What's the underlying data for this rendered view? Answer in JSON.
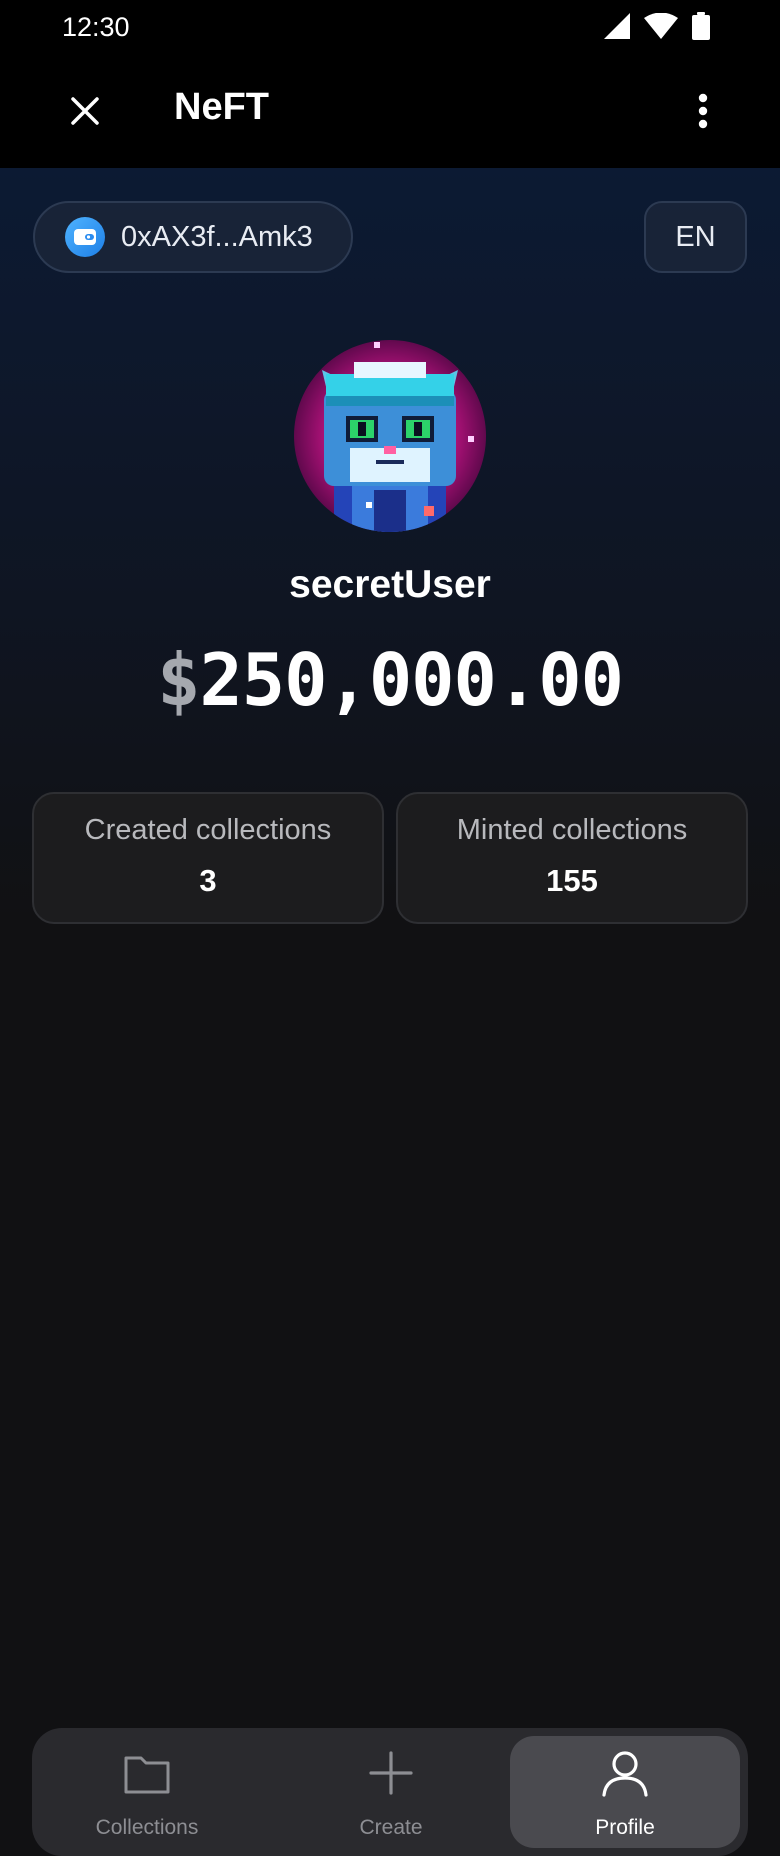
{
  "status_bar": {
    "time": "12:30",
    "icons": [
      "signal-icon",
      "wifi-icon",
      "battery-icon"
    ]
  },
  "app_bar": {
    "title": "NeFT",
    "close_icon": "close-icon",
    "menu_icon": "more-vert-icon"
  },
  "wallet": {
    "address": "0xAX3f...Amk3",
    "icon": "wallet-icon"
  },
  "language": {
    "label": "EN"
  },
  "profile": {
    "username": "secretUser",
    "balance_currency": "$",
    "balance_amount": "250,000.00"
  },
  "stats": [
    {
      "label": "Created collections",
      "value": "3"
    },
    {
      "label": "Minted collections",
      "value": "155"
    }
  ],
  "bottom_nav": {
    "items": [
      {
        "label": "Collections",
        "icon": "folder-icon",
        "active": false
      },
      {
        "label": "Create",
        "icon": "plus-icon",
        "active": false
      },
      {
        "label": "Profile",
        "icon": "person-icon",
        "active": true
      }
    ]
  },
  "colors": {
    "background": "#111113",
    "header_gradient_top": "#0c1a33",
    "card_background": "#1c1c1e",
    "nav_background": "#2a2a2e",
    "nav_active": "#4a4a4f",
    "wallet_icon": "#2a8cf0",
    "avatar_glow": "#e0208a"
  }
}
